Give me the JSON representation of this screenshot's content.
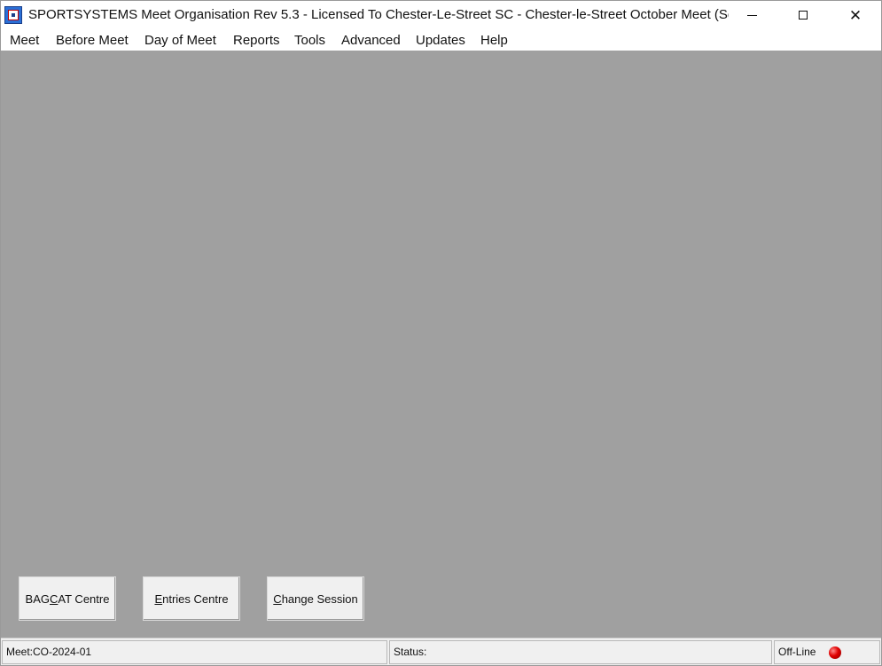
{
  "window": {
    "title": "SPORTSYSTEMS Meet Organisation Rev 5.3 - Licensed To Chester-Le-Street SC - Chester-le-Street October Meet  (Ses...",
    "app_icon": "sportsystems-app-icon",
    "controls": {
      "minimize": "minimize-icon",
      "maximize": "maximize-icon",
      "close": "close-icon"
    }
  },
  "menu": {
    "items": [
      "Meet",
      "Before Meet",
      "Day of Meet",
      "Reports",
      "Tools",
      "Advanced",
      "Updates",
      "Help"
    ]
  },
  "buttons": {
    "bagcat": {
      "before": "BAG",
      "accel": "C",
      "after": "AT Centre"
    },
    "entries": {
      "before": "",
      "accel": "E",
      "after": "ntries Centre"
    },
    "change_session": {
      "before": "",
      "accel": "C",
      "after": "hange Session"
    }
  },
  "status": {
    "meet": "Meet:CO-2024-01",
    "status": "Status:",
    "connection": "Off-Line",
    "connection_indicator_color": "#e00000"
  },
  "colors": {
    "client_background": "#a0a0a0",
    "statusbar_background": "#f0f0f0"
  }
}
